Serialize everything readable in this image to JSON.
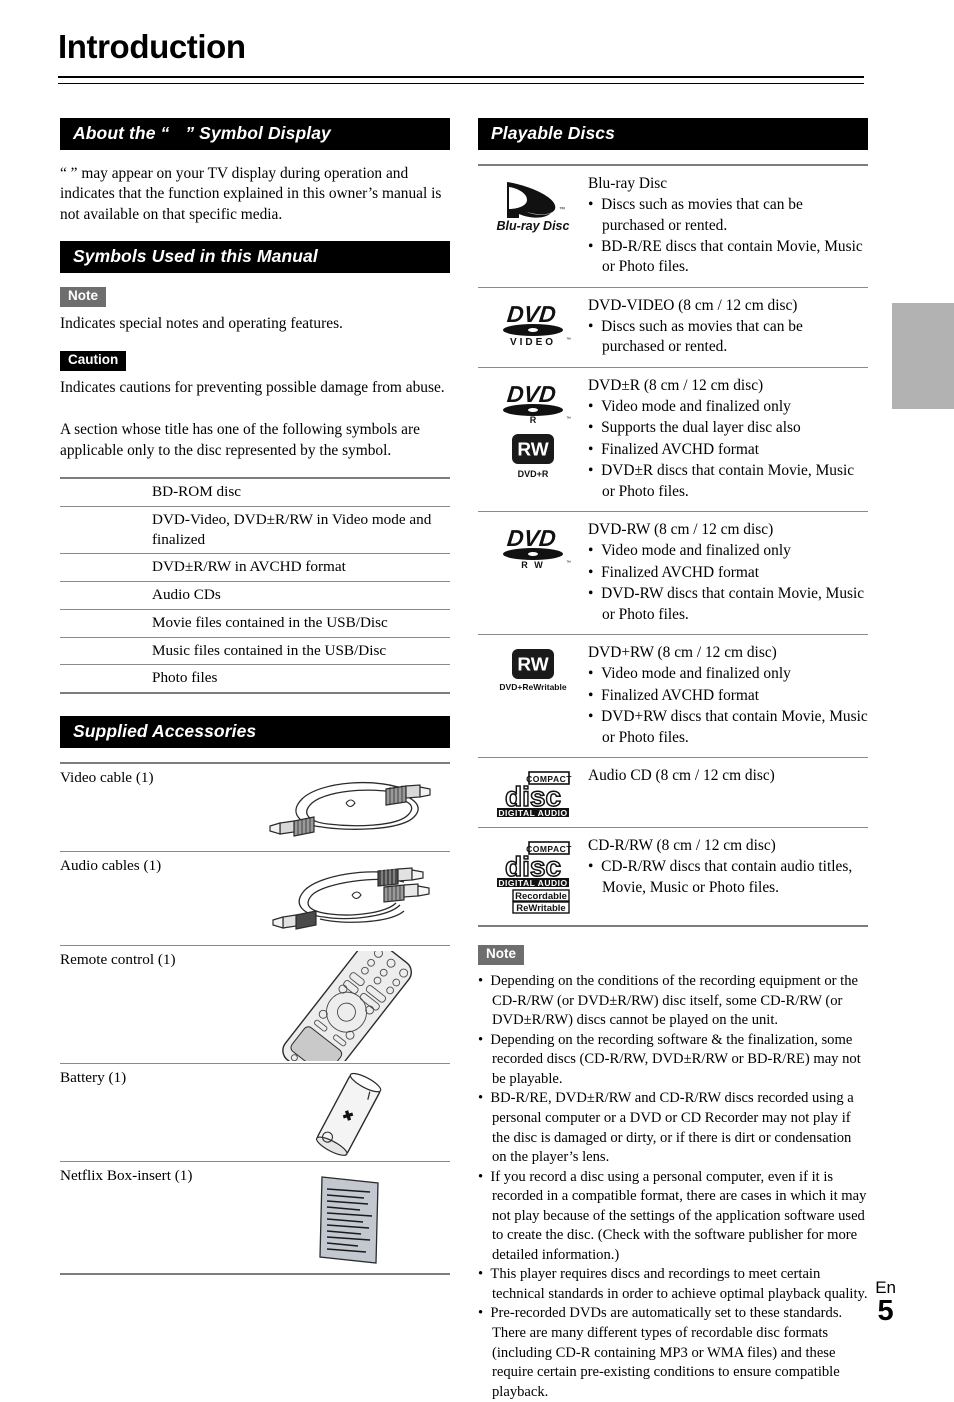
{
  "page": {
    "title": "Introduction",
    "footer_lang": "En",
    "footer_page": "5"
  },
  "left_column": {
    "symbol_display": {
      "heading_before": "About the “",
      "heading_after": "” Symbol Display",
      "paragraph": "“ ” may appear on your TV display during operation and indicates that the function explained in this owner’s manual is not available on that specific media."
    },
    "symbols_section": {
      "heading": "Symbols Used in this Manual",
      "note_badge": "Note",
      "note_text": "Indicates special notes and operating features.",
      "caution_badge": "Caution",
      "caution_text": "Indicates cautions for preventing possible damage from abuse.",
      "intro_text": "A section whose title has one of the following symbols are applicable only to the disc represented by the symbol.",
      "rows": [
        {
          "symbol": "",
          "description": "BD-ROM disc"
        },
        {
          "symbol": "",
          "description": "DVD-Video, DVD±R/RW in Video mode and finalized"
        },
        {
          "symbol": "",
          "description": "DVD±R/RW in AVCHD format"
        },
        {
          "symbol": "",
          "description": "Audio CDs"
        },
        {
          "symbol": "",
          "description": "Movie files contained in the USB/Disc"
        },
        {
          "symbol": "",
          "description": "Music files contained in the USB/Disc"
        },
        {
          "symbol": "",
          "description": "Photo files"
        }
      ]
    },
    "accessories_section": {
      "heading": "Supplied Accessories",
      "items": [
        {
          "label": "Video cable (1)",
          "art": "video-cable-illustration"
        },
        {
          "label": "Audio cables (1)",
          "art": "audio-cable-illustration"
        },
        {
          "label": "Remote control (1)",
          "art": "remote-control-illustration"
        },
        {
          "label": "Battery (1)",
          "art": "battery-illustration"
        },
        {
          "label": "Netflix Box-insert (1)",
          "art": "document-insert-illustration"
        }
      ]
    }
  },
  "right_column": {
    "playable_discs": {
      "heading": "Playable Discs",
      "rows": [
        {
          "logo": "blu-ray-disc-logo",
          "logo_text": "Blu-ray Disc",
          "title": "Blu-ray Disc",
          "bullets": [
            "Discs such as movies that can be purchased or rented.",
            "BD-R/RE discs that contain Movie, Music or Photo files."
          ]
        },
        {
          "logo": "dvd-video-logo",
          "logo_text": "DVD VIDEO",
          "title": "DVD-VIDEO (8 cm / 12 cm disc)",
          "bullets": [
            "Discs such as movies that can be purchased or rented."
          ]
        },
        {
          "logo": "dvd-r-logo",
          "logo_text": "DVD R",
          "logo2": "rw-logo",
          "logo2_caption": "DVD+R",
          "title": "DVD±R (8 cm / 12 cm disc)",
          "bullets": [
            "Video mode and finalized only",
            "Supports the dual layer disc also",
            "Finalized AVCHD format",
            "DVD±R discs that contain Movie, Music or Photo files."
          ]
        },
        {
          "logo": "dvd-rw-logo",
          "logo_text": "DVD R W",
          "title": "DVD-RW (8 cm / 12 cm disc)",
          "bullets": [
            "Video mode and finalized only",
            "Finalized AVCHD format",
            "DVD-RW discs that contain Movie, Music or Photo files."
          ]
        },
        {
          "logo": "rw-logo",
          "logo_caption": "DVD+ReWritable",
          "title": "DVD+RW (8 cm / 12 cm disc)",
          "bullets": [
            "Video mode and finalized only",
            "Finalized AVCHD format",
            "DVD+RW discs that contain Movie, Music or Photo files."
          ]
        },
        {
          "logo": "compact-disc-digital-audio-logo",
          "logo_text": "COMPACT disc DIGITAL AUDIO",
          "title": "Audio CD (8 cm / 12 cm disc)",
          "bullets": []
        },
        {
          "logo": "compact-disc-recordable-rewritable-logo",
          "logo_text": "COMPACT disc DIGITAL AUDIO",
          "logo_badge_1": "Recordable",
          "logo_badge_2": "ReWritable",
          "title": "CD-R/RW (8 cm / 12 cm disc)",
          "bullets": [
            "CD-R/RW discs that contain audio titles, Movie, Music or Photo files."
          ]
        }
      ]
    },
    "note": {
      "badge": "Note",
      "bullets": [
        "Depending on the conditions of the recording equipment or the CD-R/RW (or DVD±R/RW) disc itself, some CD-R/RW (or DVD±R/RW) discs cannot be played on the unit.",
        "Depending on the recording software & the finalization, some recorded discs (CD-R/RW, DVD±R/RW or BD-R/RE) may not be playable.",
        "BD-R/RE, DVD±R/RW and CD-R/RW discs recorded using a personal computer or a DVD or CD Recorder may not play if the disc is damaged or dirty, or if there is dirt or condensation on the player’s lens.",
        "If you record a disc using a personal computer, even if it is recorded in a compatible format, there are cases in which it may not play because of the settings of the application software used to create the disc. (Check with the software publisher for more detailed information.)",
        "This player requires discs and recordings to meet certain technical standards in order to achieve optimal playback quality.",
        "Pre-recorded DVDs are automatically set to these standards. There are many different types of recordable disc formats (including CD-R containing MP3 or WMA files) and these require certain pre-existing conditions to ensure compatible playback."
      ]
    }
  },
  "colors": {
    "banner_bg": "#000000",
    "note_badge_bg": "#6e6e6e",
    "caution_badge_bg": "#000000",
    "thumb_tab": "#b2b2b2",
    "rule": "#8a8a8a"
  }
}
